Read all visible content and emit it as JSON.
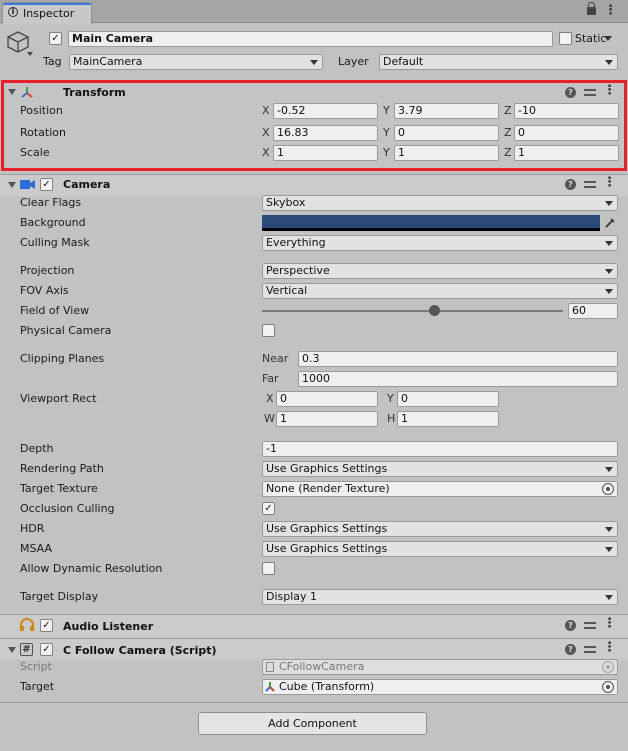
{
  "tab": {
    "title": "Inspector"
  },
  "header": {
    "name": "Main Camera",
    "static_label": "Static",
    "tag_label": "Tag",
    "tag_value": "MainCamera",
    "layer_label": "Layer",
    "layer_value": "Default"
  },
  "transform": {
    "title": "Transform",
    "position": {
      "label": "Position",
      "x": "-0.52",
      "y": "3.79",
      "z": "-10"
    },
    "rotation": {
      "label": "Rotation",
      "x": "16.83",
      "y": "0",
      "z": "0"
    },
    "scale": {
      "label": "Scale",
      "x": "1",
      "y": "1",
      "z": "1"
    }
  },
  "axis": {
    "x": "X",
    "y": "Y",
    "z": "Z",
    "w": "W",
    "h": "H"
  },
  "camera": {
    "title": "Camera",
    "clear_flags": {
      "label": "Clear Flags",
      "value": "Skybox"
    },
    "background": {
      "label": "Background",
      "color": "#2b4a78"
    },
    "culling_mask": {
      "label": "Culling Mask",
      "value": "Everything"
    },
    "projection": {
      "label": "Projection",
      "value": "Perspective"
    },
    "fov_axis": {
      "label": "FOV Axis",
      "value": "Vertical"
    },
    "field_of_view": {
      "label": "Field of View",
      "value": "60",
      "fraction": 0.57
    },
    "physical_camera": {
      "label": "Physical Camera",
      "checked": false
    },
    "clipping_planes": {
      "label": "Clipping Planes",
      "near_label": "Near",
      "near": "0.3",
      "far_label": "Far",
      "far": "1000"
    },
    "viewport_rect": {
      "label": "Viewport Rect",
      "x": "0",
      "y": "0",
      "w": "1",
      "h": "1"
    },
    "depth": {
      "label": "Depth",
      "value": "-1"
    },
    "rendering_path": {
      "label": "Rendering Path",
      "value": "Use Graphics Settings"
    },
    "target_texture": {
      "label": "Target Texture",
      "value": "None (Render Texture)"
    },
    "occlusion_culling": {
      "label": "Occlusion Culling",
      "checked": true
    },
    "hdr": {
      "label": "HDR",
      "value": "Use Graphics Settings"
    },
    "msaa": {
      "label": "MSAA",
      "value": "Use Graphics Settings"
    },
    "allow_dynamic_resolution": {
      "label": "Allow Dynamic Resolution",
      "checked": false
    },
    "target_display": {
      "label": "Target Display",
      "value": "Display 1"
    }
  },
  "audio_listener": {
    "title": "Audio Listener"
  },
  "follow_camera": {
    "title": "C Follow Camera (Script)",
    "script_label": "Script",
    "script_value": "CFollowCamera",
    "target_label": "Target",
    "target_value": "Cube (Transform)"
  },
  "add_component": {
    "label": "Add Component"
  },
  "colors": {
    "highlight": "#e8202a",
    "accent": "#3a78d8",
    "background_swatch": "#2b4a78"
  }
}
